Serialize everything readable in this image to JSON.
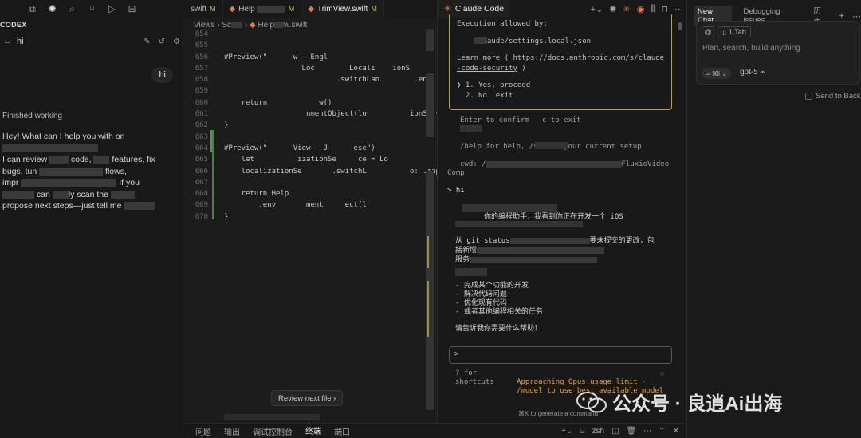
{
  "activity_bar": {
    "icons": [
      "files-icon",
      "openai-icon",
      "search-icon",
      "source-control-icon",
      "run-debug-icon",
      "extensions-icon"
    ]
  },
  "codex": {
    "title": "CODEX",
    "thread_title": "hi",
    "user_message": "hi",
    "status": "Finished working",
    "reply": [
      "Hey! What can I help you with on",
      "I can review",
      "code,",
      "features, fix",
      "bugs, tun",
      "flows,",
      "impr",
      "If you",
      "can",
      "ly scan the",
      "propose next steps—just tell me"
    ]
  },
  "editor": {
    "tabs": [
      {
        "label": "swift",
        "badge": "M"
      },
      {
        "label": "Help",
        "badge": "M"
      },
      {
        "label": "TrimView.swift",
        "badge": "M"
      }
    ],
    "breadcrumb": [
      "Views",
      "Sc",
      "Help",
      "w.swift"
    ],
    "lines": [
      {
        "n": "654",
        "t": ""
      },
      {
        "n": "655",
        "t": ""
      },
      {
        "n": "656",
        "t": "#Preview(\"      w – Engl"
      },
      {
        "n": "657",
        "t": "                  Loc        Locali    ionS"
      },
      {
        "n": "658",
        "t": "                          .switchLan        .eng"
      },
      {
        "n": "659",
        "t": ""
      },
      {
        "n": "660",
        "t": "    return            w()"
      },
      {
        "n": "661",
        "t": "                   nmentObject(lo          ionService)"
      },
      {
        "n": "662",
        "t": "}"
      },
      {
        "n": "663",
        "t": ""
      },
      {
        "n": "664",
        "t": "#Preview(\"      View – J      ese\")"
      },
      {
        "n": "665",
        "t": "    let          izationSe     ce = Lo              vi"
      },
      {
        "n": "666",
        "t": "    localizationSe       .switchL          o: .jap"
      },
      {
        "n": "667",
        "t": ""
      },
      {
        "n": "668",
        "t": "    return Help"
      },
      {
        "n": "669",
        "t": "        .env       ment     ect(l"
      },
      {
        "n": "670",
        "t": "}"
      }
    ],
    "review_button": "Review next file",
    "review_chevron": "›"
  },
  "claude": {
    "tab_label": "Claude Code",
    "perm": {
      "header": "Execution allowed by:",
      "settings": "aude/settings.local.json",
      "learn_prefix": "Learn more (",
      "learn_link_1": "https://docs.anthropic.com/s/claude",
      "learn_link_2": "-code-security",
      "learn_suffix": ")",
      "option1": "❯ 1. Yes, proceed",
      "option2": "  2. No, exit"
    },
    "confirm_hint": "Enter to confirm   c to exit",
    "help_line": "/help for help, /status     your current setup",
    "cwd_line": "cwd: /",
    "cwd_tail": "FluxioVideo",
    "comp": "Comp",
    "prompt_hi": "> hi",
    "reply_1": "你的编程助手，我看到你正在开发一个 iOS",
    "reply_2": "从 git status",
    "reply_2b": "要未提交的更改，包",
    "reply_3": "括新增",
    "reply_4": "服务",
    "list": [
      "- 完成某个功能的开发",
      "- 解决代码问题",
      "- 优化现有代码",
      "- 或者其他编程相关的任务"
    ],
    "closing": "请告诉我你需要什么帮助！",
    "input_prompt": ">",
    "shortcuts_1": "? for",
    "shortcuts_2": "shortcuts",
    "warn_1": "Approaching Opus usage limit ·",
    "warn_2": "/model to use best available model",
    "gen_hint": "⌘K to generate a command"
  },
  "chat": {
    "tabs": [
      "New Chat",
      "Debugging issues",
      "历史"
    ],
    "chip_at": "@",
    "chip_tab": "1 Tab",
    "placeholder": "Plan, search, build anything",
    "mode": "∞ ⌘I ⌄",
    "model": "gpt-5 ⌁",
    "send_background": "Send to Back"
  },
  "bottom": {
    "tabs": [
      "问题",
      "输出",
      "调试控制台",
      "终端",
      "端口"
    ],
    "active": "终端",
    "shell": "zsh"
  },
  "watermark": {
    "text": "公众号 · 良逍Ai出海"
  }
}
